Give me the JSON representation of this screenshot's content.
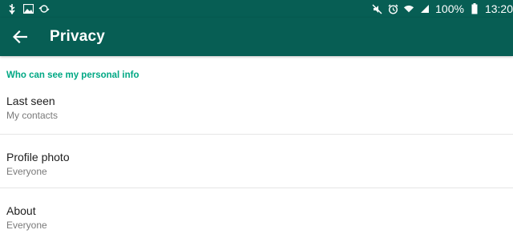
{
  "status_bar": {
    "left_icons": [
      "usb-icon",
      "image-icon",
      "sync-icon"
    ],
    "right_icons": [
      "mute-icon",
      "alarm-icon",
      "wifi-icon",
      "signal-icon"
    ],
    "battery_percent": "100%",
    "time": "13:20"
  },
  "app_bar": {
    "title": "Privacy",
    "back_icon": "arrow-back-icon",
    "background_color": "#075e54"
  },
  "section": {
    "header": "Who can see my personal info",
    "header_color": "#00a884",
    "items": [
      {
        "title": "Last seen",
        "value": "My contacts"
      },
      {
        "title": "Profile photo",
        "value": "Everyone"
      },
      {
        "title": "About",
        "value": "Everyone"
      }
    ]
  }
}
